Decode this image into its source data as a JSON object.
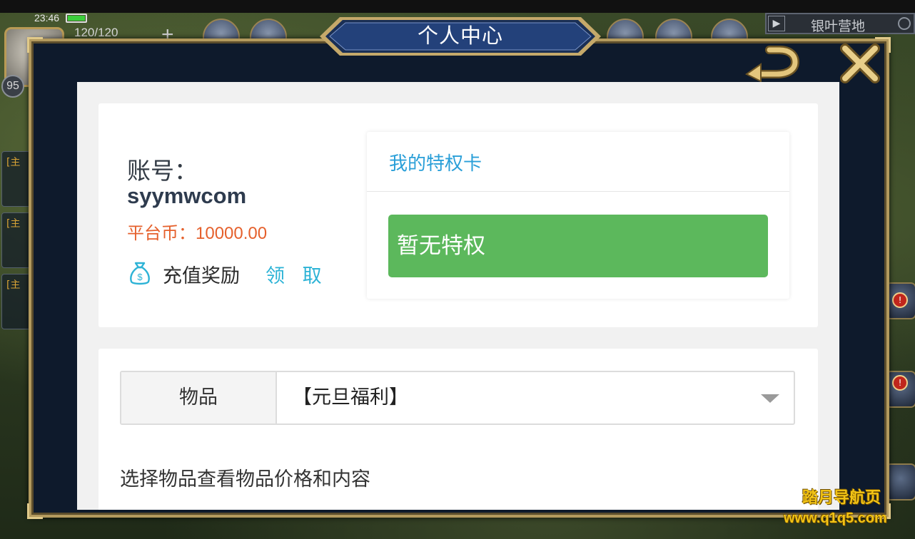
{
  "status_bar": {
    "time": "23:46",
    "stamina": "120/120",
    "level": "95"
  },
  "location": {
    "name": "银叶营地"
  },
  "side_quests": [
    {
      "label": "[主"
    },
    {
      "label": "[主"
    },
    {
      "label": "[主"
    }
  ],
  "dialog": {
    "title": "个人中心"
  },
  "account": {
    "label": "账号：",
    "name": "syymwcom",
    "coin_label": "平台币：",
    "coin_value": "10000.00",
    "recharge_label": "充值奖励",
    "claim_label": "领 取"
  },
  "privilege": {
    "title": "我的特权卡",
    "status": "暂无特权"
  },
  "items": {
    "addon_label": "物品",
    "selected": "【元旦福利】",
    "hint": "选择物品查看物品价格和内容"
  },
  "watermark": {
    "title": "踏月导航页",
    "url": "www.q1q5.com"
  },
  "colors": {
    "dialog_bg": "#0e1a2c",
    "frame_gold": "#b39a5e",
    "link_blue": "#2db3d6",
    "privilege_blue": "#2a9fd8",
    "coin_orange": "#e5602c",
    "success_green": "#5cb85c"
  },
  "icons": {
    "back": "back-arrow-icon",
    "close": "close-x-icon",
    "moneybag": "money-bag-icon",
    "dropdown": "chevron-down-icon"
  }
}
